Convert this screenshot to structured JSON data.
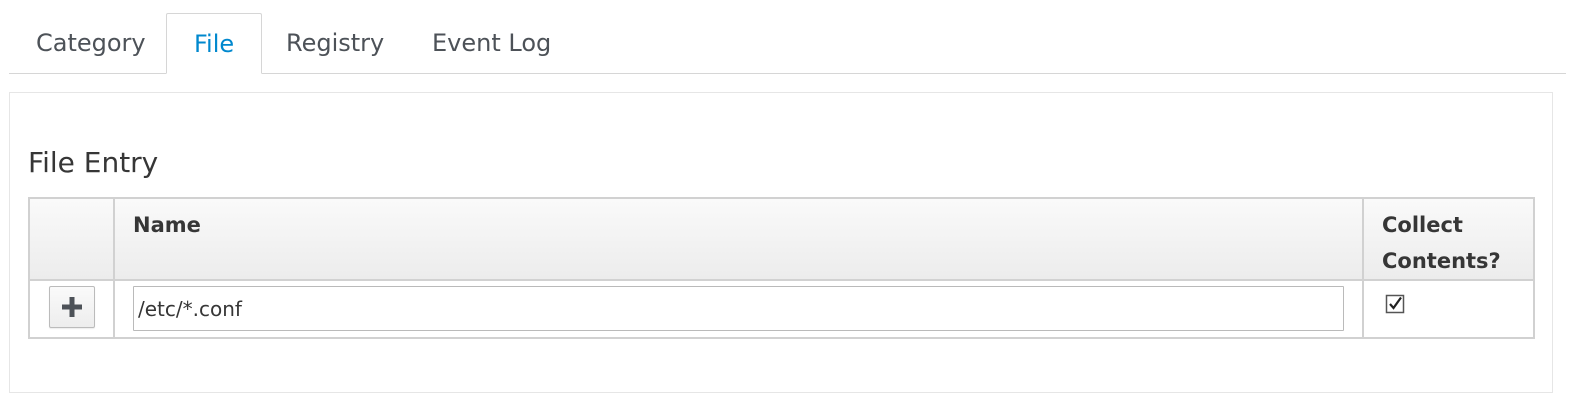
{
  "tabs": [
    {
      "label": "Category",
      "active": false
    },
    {
      "label": "File",
      "active": true
    },
    {
      "label": "Registry",
      "active": false
    },
    {
      "label": "Event Log",
      "active": false
    }
  ],
  "panel": {
    "title": "File Entry",
    "table": {
      "columns": [
        "",
        "Name",
        "Collect Contents?"
      ],
      "rows": [
        {
          "action_icon": "plus-icon",
          "name_value": "/etc/*.conf",
          "collect_contents": true
        }
      ]
    }
  },
  "colors": {
    "active_tab": "#0088ce",
    "text": "#363636",
    "border": "#d1d1d1"
  }
}
